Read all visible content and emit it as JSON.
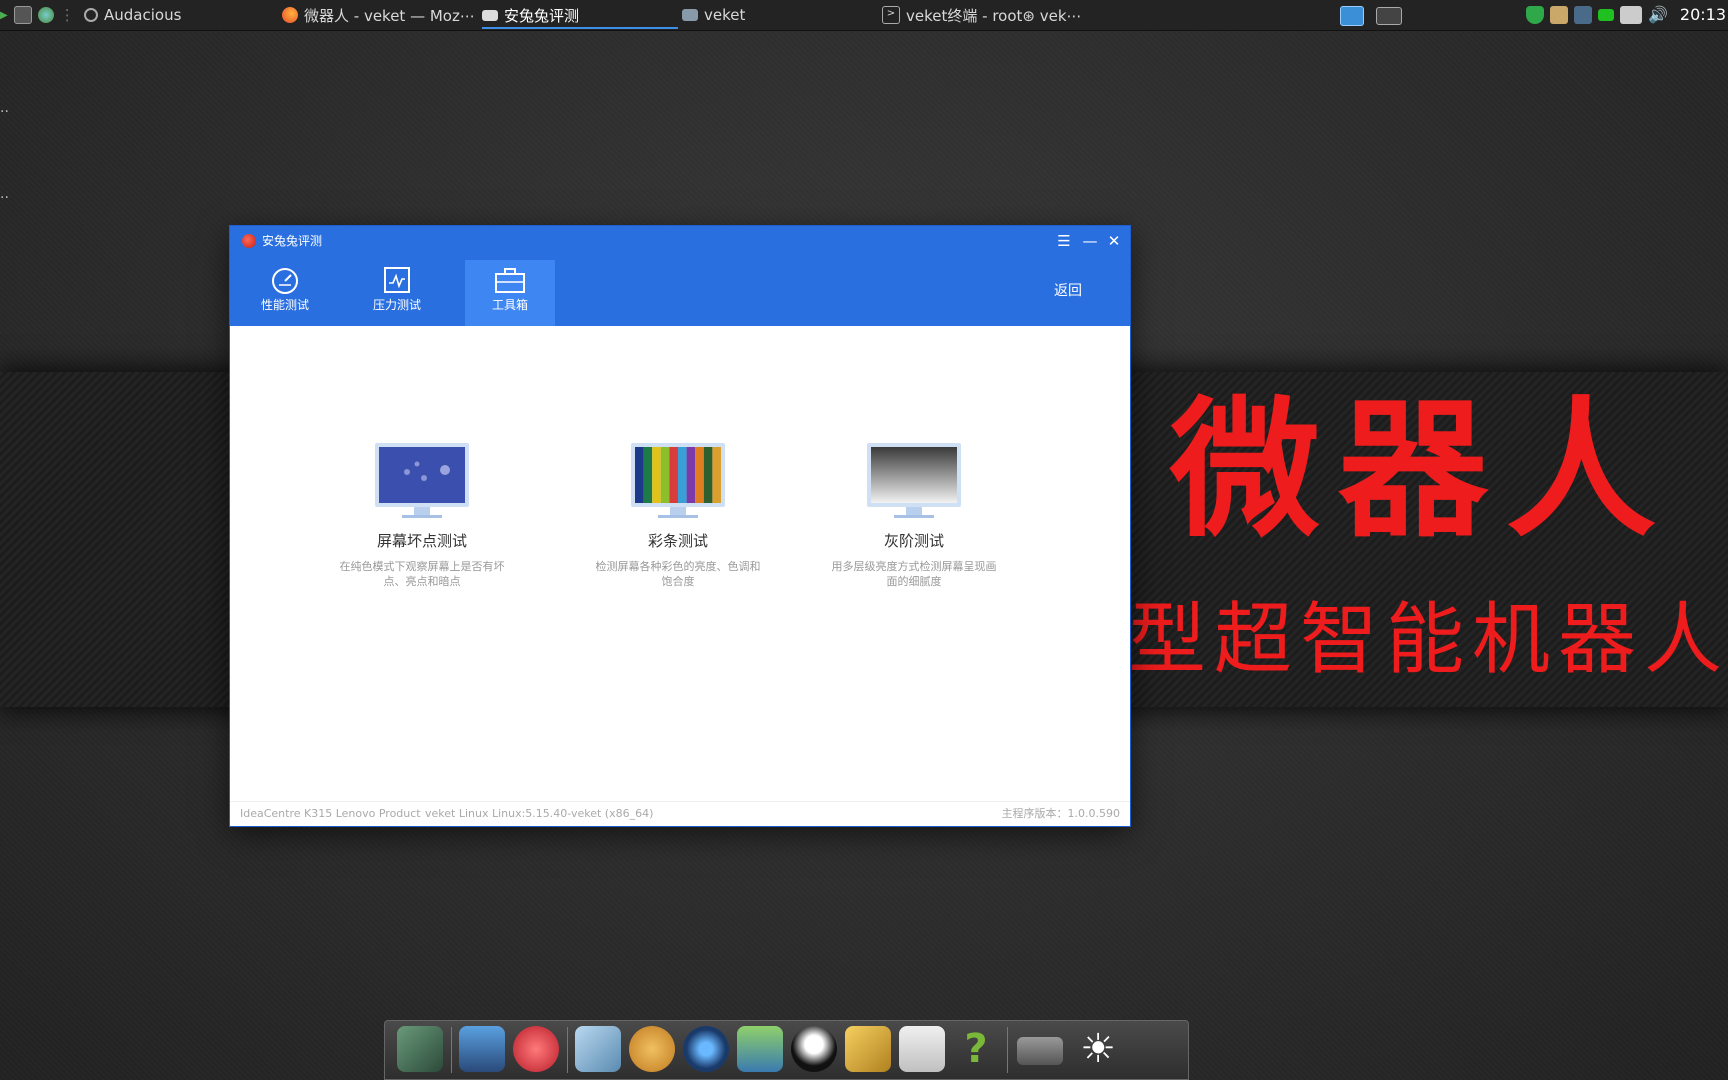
{
  "taskbar": {
    "launchers": [
      {
        "name": "terminal-launcher-icon",
        "color": "#555555"
      },
      {
        "name": "browser-launcher-icon",
        "color": "#4a8a3a"
      },
      {
        "name": "audacious-launcher-icon",
        "color": "#888888"
      }
    ],
    "tasks": [
      {
        "label": "Audacious",
        "icon": "audacious-icon",
        "active": false
      },
      {
        "label": "微器人 - veket — Moz⋯",
        "icon": "firefox-icon",
        "active": false
      },
      {
        "label": "安兔兔评测",
        "icon": "window-icon",
        "active": true
      },
      {
        "label": "veket",
        "icon": "folder-icon",
        "active": false
      },
      {
        "label": "veket终端 - root⊛ vek⋯",
        "icon": "terminal-icon",
        "active": false
      }
    ],
    "clock": "20:13"
  },
  "desktop": {
    "banner_title": "微器人",
    "banner_subtitle": "型超智能机器人"
  },
  "window": {
    "title": "安兔兔评测",
    "nav": [
      {
        "label": "性能测试",
        "icon": "speedometer-icon",
        "active": false
      },
      {
        "label": "压力测试",
        "icon": "chip-monitor-icon",
        "active": false
      },
      {
        "label": "工具箱",
        "icon": "toolbox-icon",
        "active": true
      }
    ],
    "back_label": "返回",
    "tools": [
      {
        "name": "屏幕坏点测试",
        "desc": "在纯色模式下观察屏幕上是否有坏点、亮点和暗点"
      },
      {
        "name": "彩条测试",
        "desc": "检测屏幕各种彩色的亮度、色调和饱合度"
      },
      {
        "name": "灰阶测试",
        "desc": "用多层级亮度方式检测屏幕呈现画面的细腻度"
      }
    ],
    "footer": {
      "model": "IdeaCentre K315 Lenovo Product",
      "os": "veket Linux Linux:5.15.40-veket (x86_64)",
      "version": "主程序版本：1.0.0.590"
    }
  },
  "colors": {
    "header_blue": "#2a6fe0",
    "active_tab_blue": "#3e86f2",
    "banner_red": "#ee1c1c"
  }
}
